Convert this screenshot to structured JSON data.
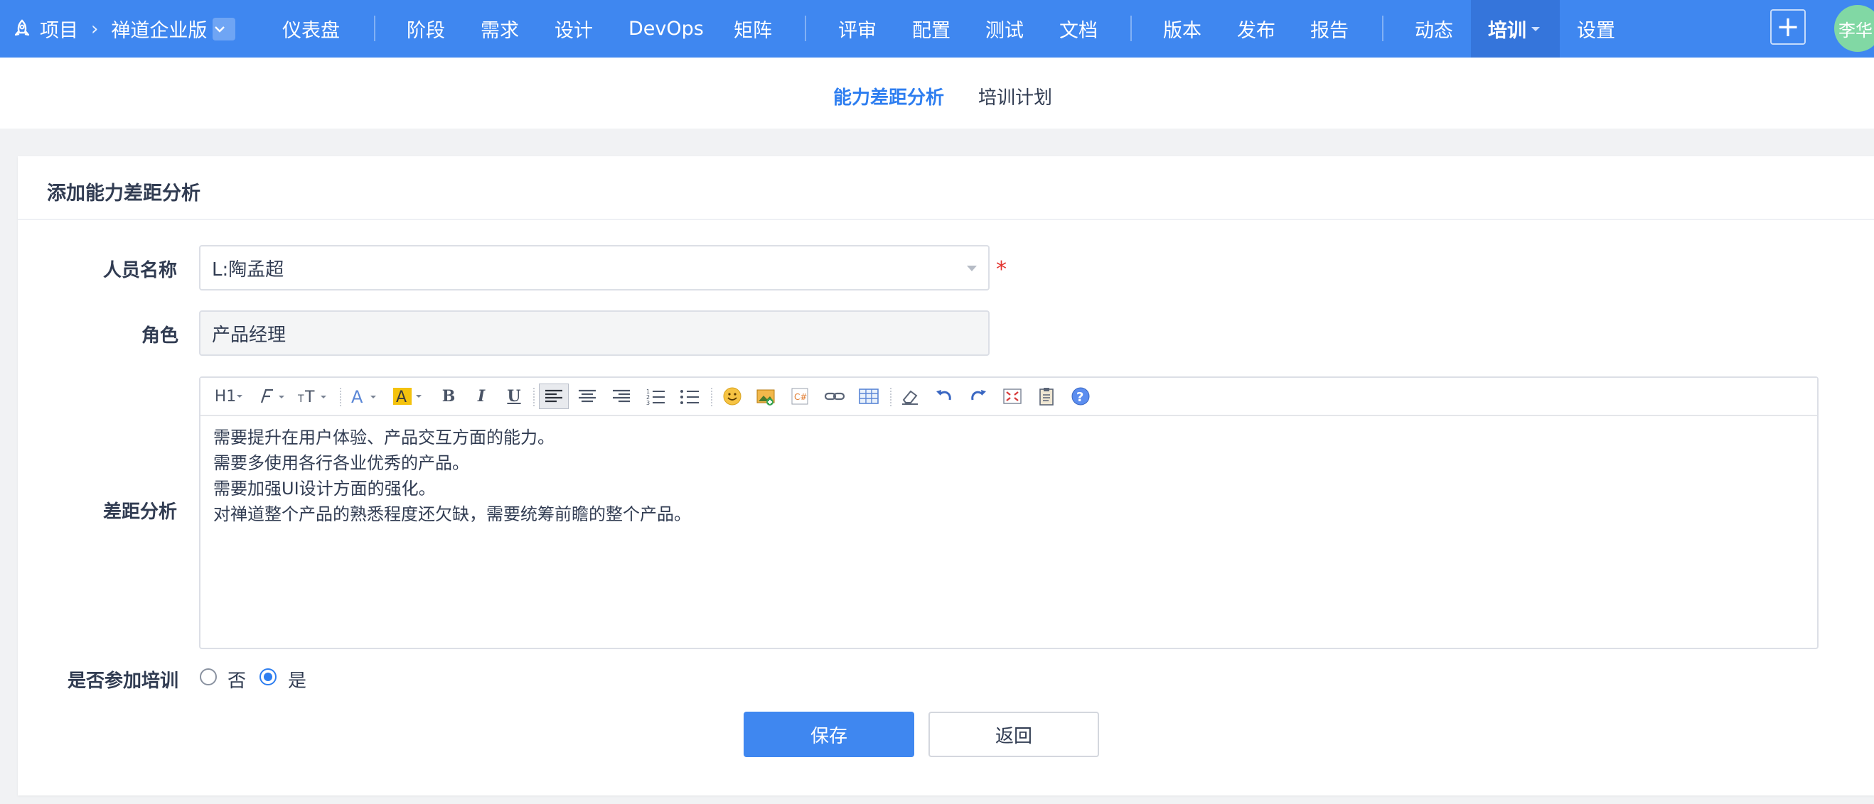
{
  "topbar": {
    "project_label": "项目",
    "breadcrumb_sep": "›",
    "edition": "禅道企业版",
    "items": [
      {
        "label": "仪表盘"
      },
      {
        "label": "阶段"
      },
      {
        "label": "需求"
      },
      {
        "label": "设计"
      },
      {
        "label": "DevOps"
      },
      {
        "label": "矩阵"
      },
      {
        "label": "评审"
      },
      {
        "label": "配置"
      },
      {
        "label": "测试"
      },
      {
        "label": "文档"
      },
      {
        "label": "版本"
      },
      {
        "label": "发布"
      },
      {
        "label": "报告"
      },
      {
        "label": "动态"
      },
      {
        "label": "培训"
      },
      {
        "label": "设置"
      }
    ],
    "active_item": "培训",
    "plus": "+",
    "avatar_text": "李华",
    "bg_color": "#3f87f0",
    "avatar_color": "#81d8a4"
  },
  "subnav": {
    "tabs": [
      {
        "label": "能力差距分析",
        "active": true
      },
      {
        "label": "培训计划",
        "active": false
      }
    ]
  },
  "form": {
    "title": "添加能力差距分析",
    "person": {
      "label": "人员名称",
      "value": "L:陶孟超",
      "required_mark": "*"
    },
    "role": {
      "label": "角色",
      "value": "产品经理"
    },
    "gap": {
      "label": "差距分析",
      "toolbar_icons": [
        "heading-icon",
        "font-family-icon",
        "font-size-icon",
        "font-color-icon",
        "highlight-color-icon",
        "bold-icon",
        "italic-icon",
        "underline-icon",
        "align-left-icon",
        "align-center-icon",
        "align-right-icon",
        "ordered-list-icon",
        "unordered-list-icon",
        "emoji-icon",
        "image-icon",
        "code-icon",
        "link-icon",
        "table-icon",
        "clear-format-icon",
        "undo-icon",
        "redo-icon",
        "fullscreen-icon",
        "paste-icon",
        "help-icon"
      ],
      "toolbar": {
        "heading": "H1",
        "bold": "B",
        "italic": "I",
        "underline": "U"
      },
      "lines": [
        "需要提升在用户体验、产品交互方面的能力。",
        "需要多使用各行各业优秀的产品。",
        "需要加强UI设计方面的强化。",
        "对禅道整个产品的熟悉程度还欠缺，需要统筹前瞻的整个产品。"
      ]
    },
    "training": {
      "label": "是否参加培训",
      "options": [
        {
          "label": "否",
          "checked": false
        },
        {
          "label": "是",
          "checked": true
        }
      ]
    },
    "save_label": "保存",
    "back_label": "返回"
  },
  "colors": {
    "accent": "#2e7ef0",
    "required": "#e3342f"
  }
}
